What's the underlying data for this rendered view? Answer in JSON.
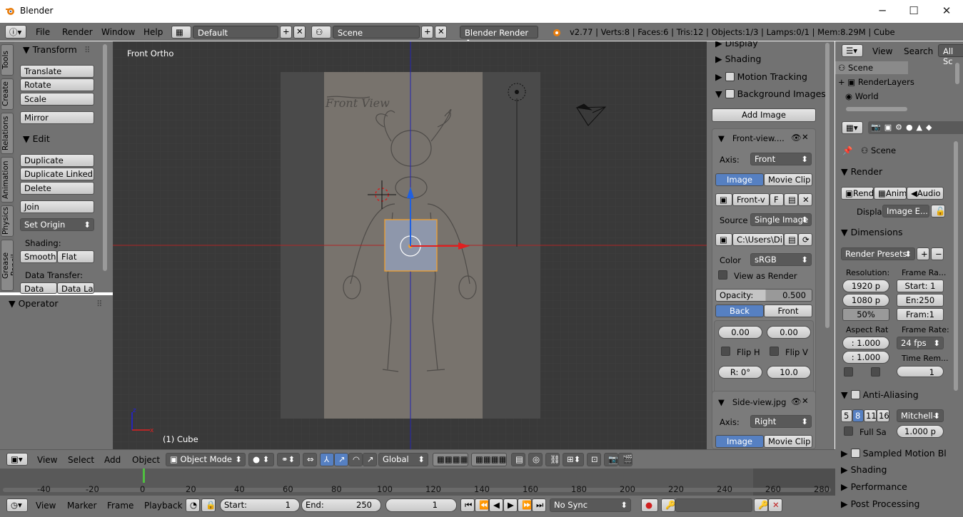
{
  "window": {
    "title": "Blender",
    "minimize": "─",
    "maximize": "☐",
    "close": "✕"
  },
  "infobar": {
    "menus": [
      "File",
      "Render",
      "Window",
      "Help"
    ],
    "layout": "Default",
    "scene": "Scene",
    "engine": "Blender Render",
    "stats": "v2.77 | Verts:8 | Faces:6 | Tris:12 | Objects:1/3 | Lamps:0/1 | Mem:8.29M | Cube"
  },
  "tabs": [
    "Tools",
    "Create",
    "Relations",
    "Animation",
    "Physics",
    "Grease Pencil"
  ],
  "shelf": {
    "transform": "Transform",
    "translate": "Translate",
    "rotate": "Rotate",
    "scale": "Scale",
    "mirror": "Mirror",
    "edit": "Edit",
    "duplicate": "Duplicate",
    "duplicate_linked": "Duplicate Linked",
    "delete": "Delete",
    "join": "Join",
    "set_origin": "Set Origin",
    "shading": "Shading:",
    "smooth": "Smooth",
    "flat": "Flat",
    "data_transfer": "Data Transfer:",
    "data": "Data",
    "data_la": "Data La",
    "operator": "Operator"
  },
  "viewport": {
    "view_name": "Front Ortho",
    "object_label": "(1) Cube",
    "sketch_text": "Front View"
  },
  "npanel": {
    "display": "Display",
    "shading": "Shading",
    "motion_tracking": "Motion Tracking",
    "background_images": "Background Images",
    "add_image": "Add Image",
    "front_title": "Front-view....",
    "axis_label": "Axis:",
    "axis_front": "Front",
    "image": "Image",
    "movie_clip": "Movie Clip",
    "front_v": "Front-v",
    "f": "F",
    "source_label": "Source",
    "source_value": "Single Image",
    "path": "C:\\Users\\Di...",
    "color_label": "Color",
    "color_value": "sRGB",
    "view_as_render": "View as Render",
    "opacity_label": "Opacity:",
    "opacity_value": "0.500",
    "back": "Back",
    "front": "Front",
    "x": "0.00",
    "y": "0.00",
    "flip_h": "Flip H",
    "flip_v": "Flip V",
    "rot": "R: 0°",
    "size": "10.0",
    "side_title": "Side-view.jpg",
    "axis_right": "Right"
  },
  "outliner": {
    "view": "View",
    "search": "Search",
    "all_scenes": "All Sc",
    "scene": "Scene",
    "render_layers": "RenderLayers",
    "world": "World"
  },
  "props": {
    "scene": "Scene",
    "render": "Render",
    "rend": "Rend",
    "anim": "Anim",
    "audio": "Audio",
    "display_label": "Display",
    "display_value": "Image E...",
    "dimensions": "Dimensions",
    "render_presets": "Render Presets",
    "resolution": "Resolution:",
    "res_x": "1920 p",
    "res_y": "1080 p",
    "res_pct": "50%",
    "frame_range": "Frame Ra...",
    "start": "Start: 1",
    "end": "En:250",
    "frame": "Fram:1",
    "aspect": "Aspect Rat",
    "asp_x": ": 1.000",
    "asp_y": ": 1.000",
    "frame_rate": "Frame Rate:",
    "fps": "24 fps",
    "time_rem": "Time Rem...",
    "time_val": "1",
    "anti_aliasing": "Anti-Aliasing",
    "aa": [
      "5",
      "8",
      "11",
      "16"
    ],
    "filter": "Mitchell-",
    "full_sample": "Full Sa",
    "filter_size": "1.000 p",
    "sampled_motion": "Sampled Motion Bl",
    "shading": "Shading",
    "performance": "Performance",
    "post_processing": "Post Processing"
  },
  "vphdr": {
    "menus": [
      "View",
      "Select",
      "Add",
      "Object"
    ],
    "mode": "Object Mode",
    "orientation": "Global"
  },
  "timeline": {
    "ticks": [
      "-40",
      "-20",
      "0",
      "20",
      "40",
      "60",
      "80",
      "100",
      "120",
      "140",
      "160",
      "180",
      "200",
      "220",
      "240",
      "260",
      "280"
    ],
    "current_frame": 0
  },
  "tlhdr": {
    "menus": [
      "View",
      "Marker",
      "Frame",
      "Playback"
    ],
    "start": "Start:",
    "start_val": "1",
    "end": "End:",
    "end_val": "250",
    "current": "1",
    "sync": "No Sync"
  },
  "colors": {
    "panel": "#727272",
    "viewport": "#393939",
    "selected": "#5680c2",
    "x_axis": "#e02020",
    "z_axis": "#2020e0",
    "selection": "#f0a030"
  }
}
